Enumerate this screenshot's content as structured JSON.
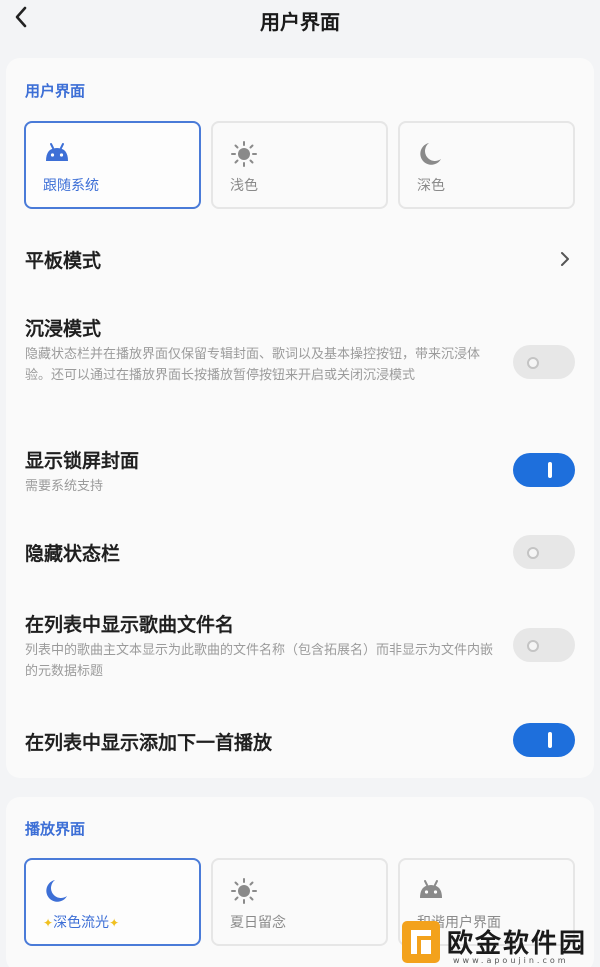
{
  "header": {
    "title": "用户界面"
  },
  "ui_section": {
    "title": "用户界面",
    "themes": [
      {
        "label": "跟随系统",
        "icon": "android-icon",
        "selected": true
      },
      {
        "label": "浅色",
        "icon": "sun-icon",
        "selected": false
      },
      {
        "label": "深色",
        "icon": "moon-icon",
        "selected": false
      }
    ]
  },
  "settings": {
    "tablet": {
      "title": "平板模式"
    },
    "immersive": {
      "title": "沉浸模式",
      "desc": "隐藏状态栏并在播放界面仅保留专辑封面、歌词以及基本操控按钮，带来沉浸体验。还可以通过在播放界面长按播放暂停按钮来开启或关闭沉浸模式",
      "on": false
    },
    "lockscreen": {
      "title": "显示锁屏封面",
      "desc": "需要系统支持",
      "on": true
    },
    "hide_statusbar": {
      "title": "隐藏状态栏",
      "on": false
    },
    "show_filename": {
      "title": "在列表中显示歌曲文件名",
      "desc": "列表中的歌曲主文本显示为此歌曲的文件名称（包含拓展名）而非显示为文件内嵌的元数据标题",
      "on": false
    },
    "show_add_next": {
      "title": "在列表中显示添加下一首播放",
      "on": true
    }
  },
  "player_section": {
    "title": "播放界面",
    "styles": [
      {
        "label": "深色流光",
        "icon": "moon-icon",
        "selected": true
      },
      {
        "label": "夏日留念",
        "icon": "sun-icon",
        "selected": false
      },
      {
        "label": "和谐用户界面",
        "icon": "android-icon",
        "selected": false
      }
    ]
  },
  "watermark": {
    "text": "欧金软件园",
    "url": "www.apoujin.com"
  },
  "colors": {
    "accent": "#1e6fdc",
    "section": "#3d6fd6",
    "background": "#f3f4f6"
  }
}
